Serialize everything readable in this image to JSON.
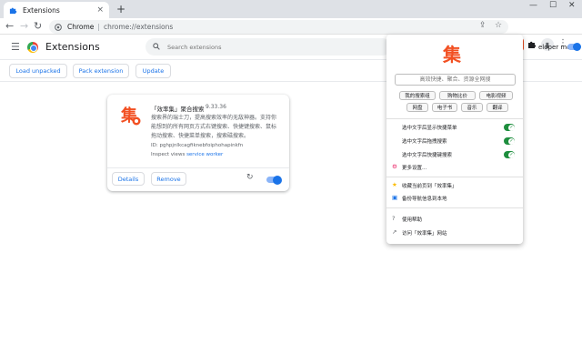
{
  "browser": {
    "tab_title": "Extensions",
    "tab_icon": "puzzle-icon",
    "new_tab": "+",
    "omnibox_site": "Chrome",
    "omnibox_url": "chrome://extensions"
  },
  "header": {
    "title": "Extensions",
    "search_placeholder": "Search extensions",
    "dev_mode_label": "eloper mode",
    "dev_mode_on": true
  },
  "actions": {
    "load_unpacked": "Load unpacked",
    "pack_extension": "Pack extension",
    "update": "Update"
  },
  "extension_card": {
    "name": "「效率集」聚合搜索",
    "version": "9.33.36",
    "description": "搜索界的瑞士刀，提高搜索效率的无敌神器。支持你能想到的所有网页方式右键搜索、快捷键搜索、鼠标拖动搜索、快捷菜单搜索，搜索磁搜索。",
    "id_line": "ID: pghpjnlkcagfiknebfoiphohapinkfn",
    "inspect_label": "Inspect views",
    "inspect_link": "service worker",
    "details_label": "Details",
    "remove_label": "Remove",
    "enabled": true
  },
  "popup": {
    "logo_char": "集",
    "search_placeholder": "高效快捷、聚合、资源全网搜",
    "chips_row1": [
      "我的搜索组",
      "购物比价",
      "电影视频"
    ],
    "chips_row2": [
      "网盘",
      "电子书",
      "音乐",
      "翻译"
    ],
    "toggles": [
      {
        "label": "选中文字后显示快捷菜单",
        "on": true
      },
      {
        "label": "选中文字后拖拽搜索",
        "on": true
      },
      {
        "label": "选中文字后快捷键搜索",
        "on": true
      }
    ],
    "more_settings": "更多设置...",
    "bookmark": "收藏当前页到「效率集」",
    "backup": "备份导航信息到本地",
    "help": "使用帮助",
    "visit": "访问「效率集」网站"
  }
}
